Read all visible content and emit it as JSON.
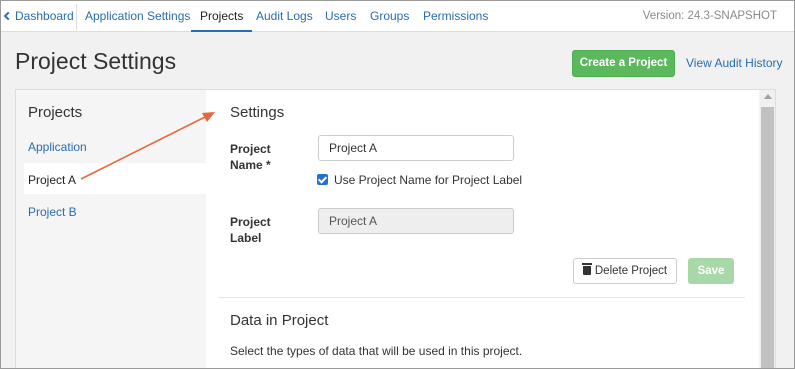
{
  "nav": {
    "dashboard": "Dashboard",
    "items": [
      "Application Settings",
      "Projects",
      "Audit Logs",
      "Users",
      "Groups",
      "Permissions"
    ],
    "active": "Projects",
    "version": "Version: 24.3-SNAPSHOT"
  },
  "header": {
    "title": "Project Settings",
    "create_button": "Create a Project",
    "audit_link": "View Audit History"
  },
  "sidebar": {
    "title": "Projects",
    "items": [
      {
        "label": "Application"
      },
      {
        "label": "Project A"
      },
      {
        "label": "Project B"
      }
    ]
  },
  "settings": {
    "title": "Settings",
    "name_label": "Project Name  *",
    "name_value": "Project A",
    "checkbox_label": "Use Project Name for Project Label",
    "checkbox_checked": true,
    "label_label": "Project Label",
    "label_value": "Project A",
    "delete_button": "Delete Project",
    "save_button": "Save"
  },
  "data_section": {
    "title": "Data in Project",
    "description": "Select the types of data that will be used in this project."
  },
  "colors": {
    "link": "#2a6cb0",
    "create_button": "#5cb85c",
    "save_disabled": "#a8d8a8",
    "annotation_arrow": "#e8673a"
  }
}
